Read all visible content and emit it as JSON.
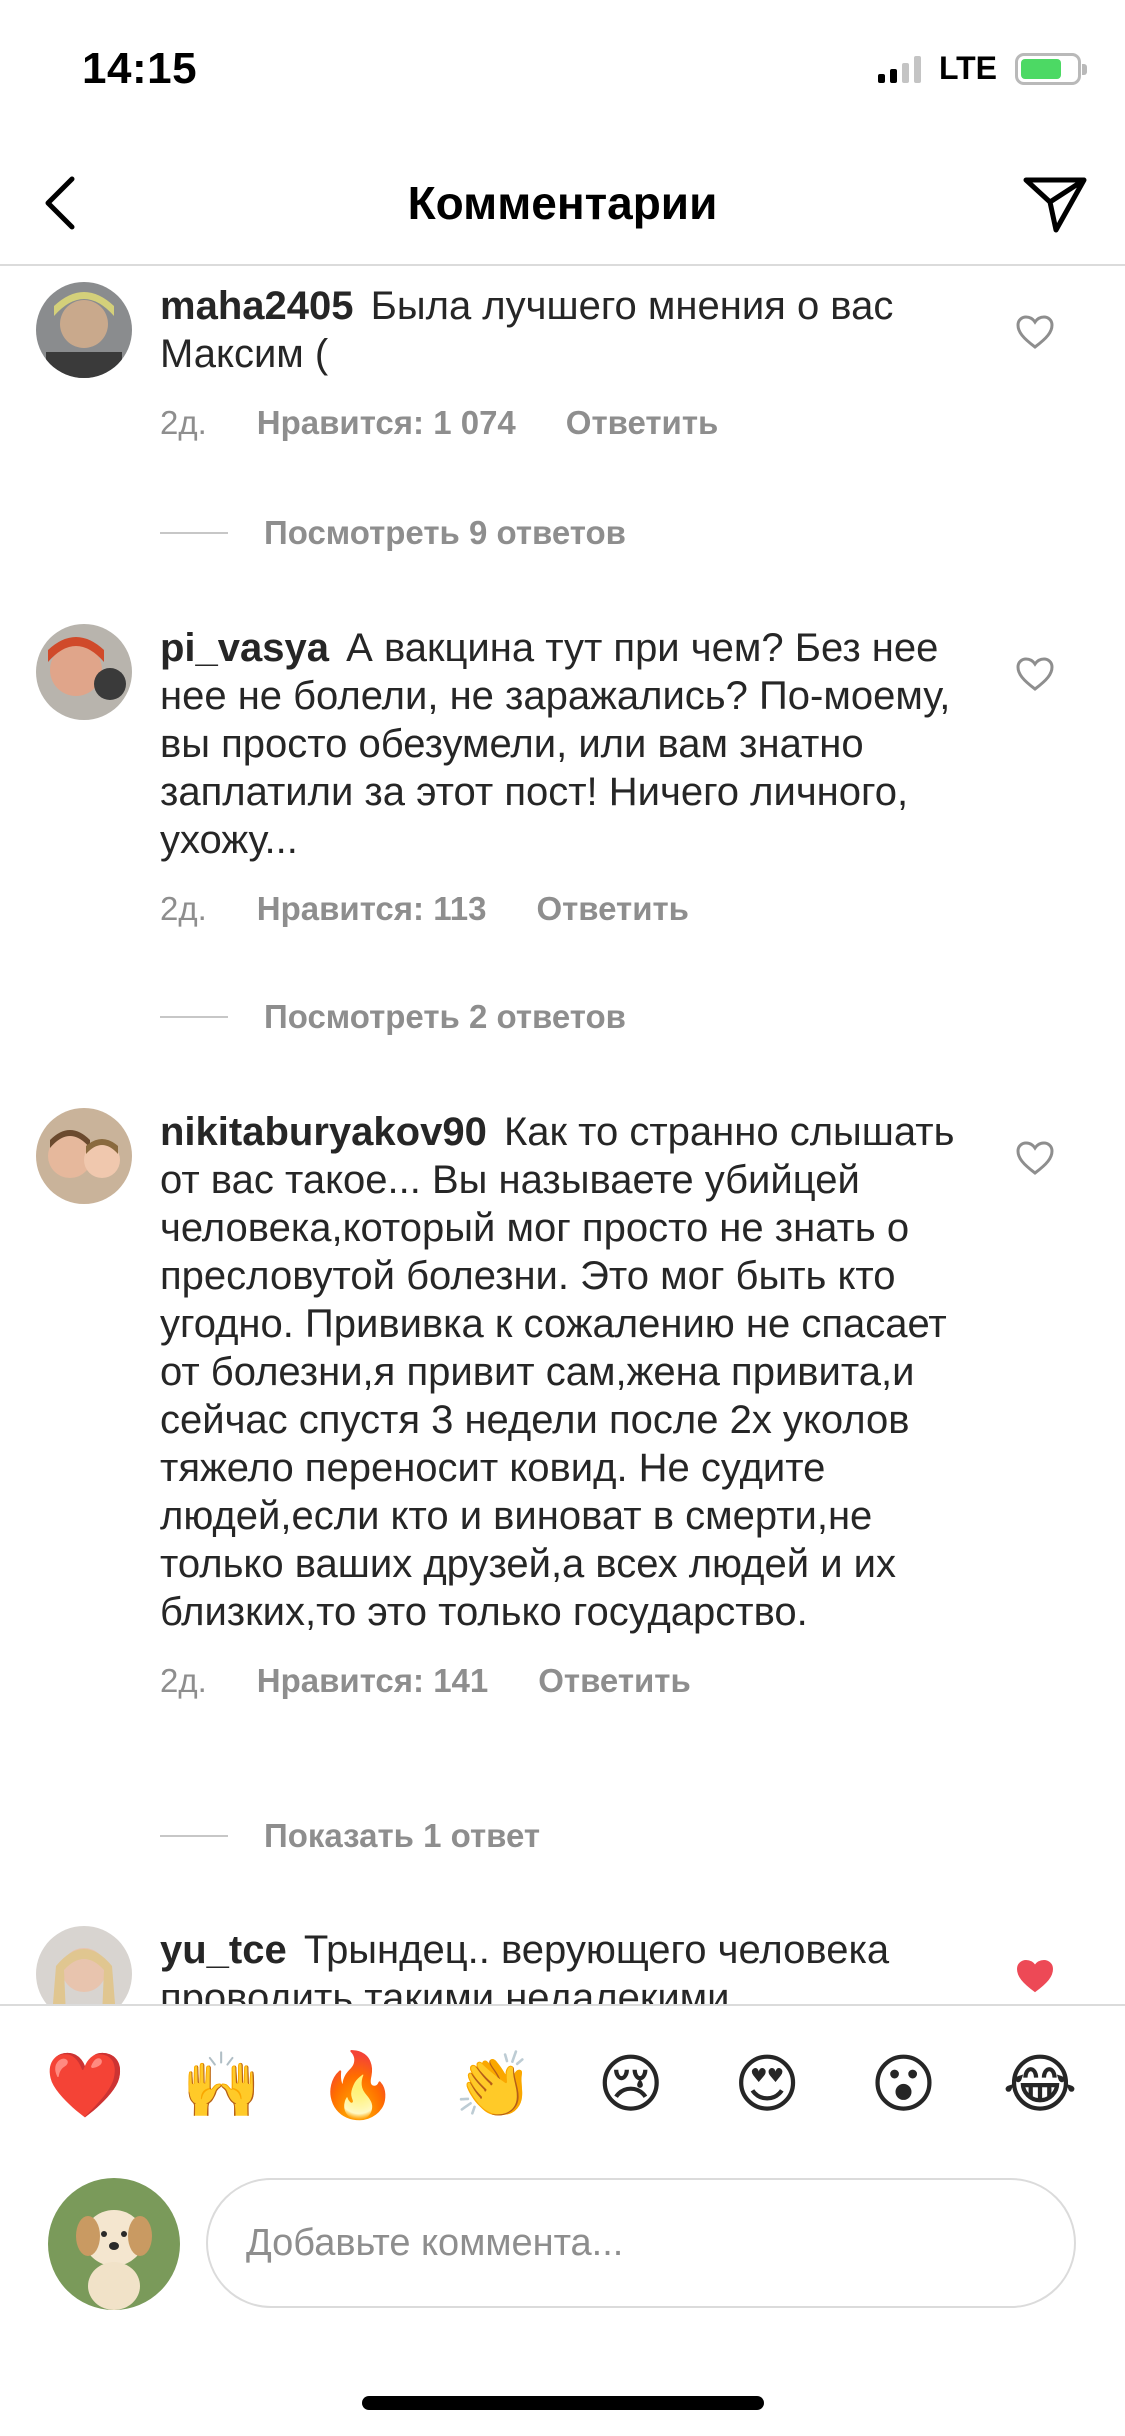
{
  "status_bar": {
    "time": "14:15",
    "network": "LTE"
  },
  "header": {
    "title": "Комментарии",
    "back_icon": "chevron-left-icon",
    "share_icon": "paper-plane-icon"
  },
  "comments": [
    {
      "username": "maha2405",
      "text": "Была лучшего мнения о вас Максим (",
      "time": "2д.",
      "likes": "Нравится: 1 074",
      "reply": "Ответить",
      "liked": false,
      "view_replies": "Посмотреть 9 ответов"
    },
    {
      "username": "pi_vasya",
      "text": "А вакцина тут при чем? Без нее нее не болели, не заражались? По-моему, вы просто обезумели, или вам знатно заплатили за этот пост! Ничего личного, ухожу...",
      "time": "2д.",
      "likes": "Нравится: 113",
      "reply": "Ответить",
      "liked": false,
      "view_replies": "Посмотреть 2 ответов"
    },
    {
      "username": "nikitaburyakov90",
      "text": "Как то странно слышать от вас такое... Вы называете убийцей человека,который мог просто не знать о пресловутой болезни. Это мог быть кто угодно. Прививка к сожалению не спасает от болезни,я привит сам,жена привита,и сейчас спустя 3 недели после 2х уколов тяжело переносит ковид. Не судите людей,если кто и виноват в смерти,не только ваших друзей,а всех людей и их близких,то это только государство.",
      "time": "2д.",
      "likes": "Нравится: 141",
      "reply": "Ответить",
      "liked": false,
      "view_replies": "Показать 1 ответ"
    },
    {
      "username": "yu_tce",
      "text": "Трындец.. верующего человека проводить такими недалекими",
      "liked": true
    }
  ],
  "emoji_bar": [
    "❤️",
    "🙌",
    "🔥",
    "👏",
    "😢",
    "😍",
    "😮",
    "😂"
  ],
  "input": {
    "placeholder": "Добавьте коммента..."
  },
  "colors": {
    "text": "#262626",
    "secondary": "#8e8e8e",
    "like_red": "#ed4956",
    "divider": "#dbdbdb"
  }
}
